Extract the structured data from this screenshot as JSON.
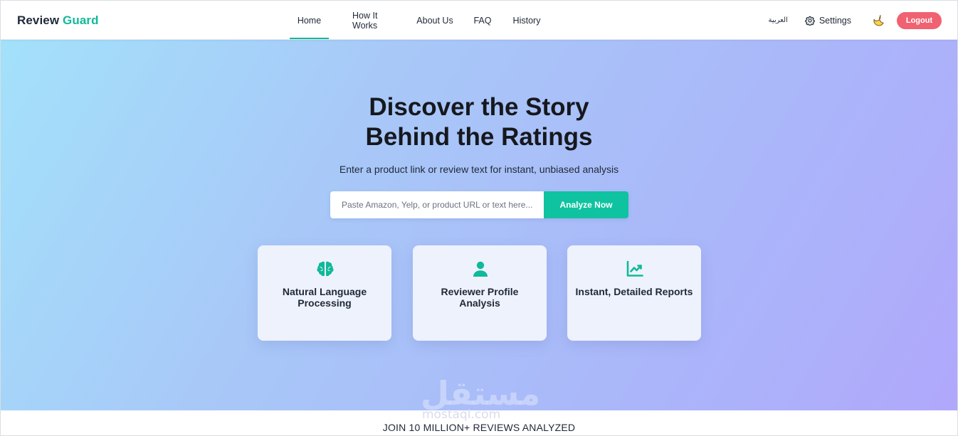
{
  "brand": {
    "part1": "Review",
    "part2": "Guard"
  },
  "nav": {
    "links": [
      {
        "label": "Home",
        "active": true
      },
      {
        "label": "How It Works"
      },
      {
        "label": "About Us"
      },
      {
        "label": "FAQ"
      },
      {
        "label": "History"
      }
    ],
    "language_label": "العربية",
    "settings_label": "Settings",
    "settings_icon": "gear-icon",
    "theme_icon": "moon-icon",
    "logout_label": "Logout"
  },
  "hero": {
    "headline_line1": "Discover the Story",
    "headline_line2": "Behind the Ratings",
    "subtitle": "Enter a product link or review text for instant, unbiased analysis",
    "search_placeholder": "Paste Amazon, Yelp, or product URL or text here...",
    "search_value": "",
    "analyze_label": "Analyze Now"
  },
  "features": [
    {
      "icon": "brain-icon",
      "title": "Natural Language Processing"
    },
    {
      "icon": "user-icon",
      "title": "Reviewer Profile Analysis"
    },
    {
      "icon": "chart-line-icon",
      "title": "Instant, Detailed Reports"
    }
  ],
  "watermark": {
    "text": "مستقل",
    "domain": "mostaql.com"
  },
  "banner": {
    "text": "JOIN 10 MILLION+ REVIEWS ANALYZED"
  },
  "colors": {
    "accent": "#10b99a",
    "button": "#10c3a0",
    "logout": "#f06272",
    "dark": "#16181d"
  }
}
